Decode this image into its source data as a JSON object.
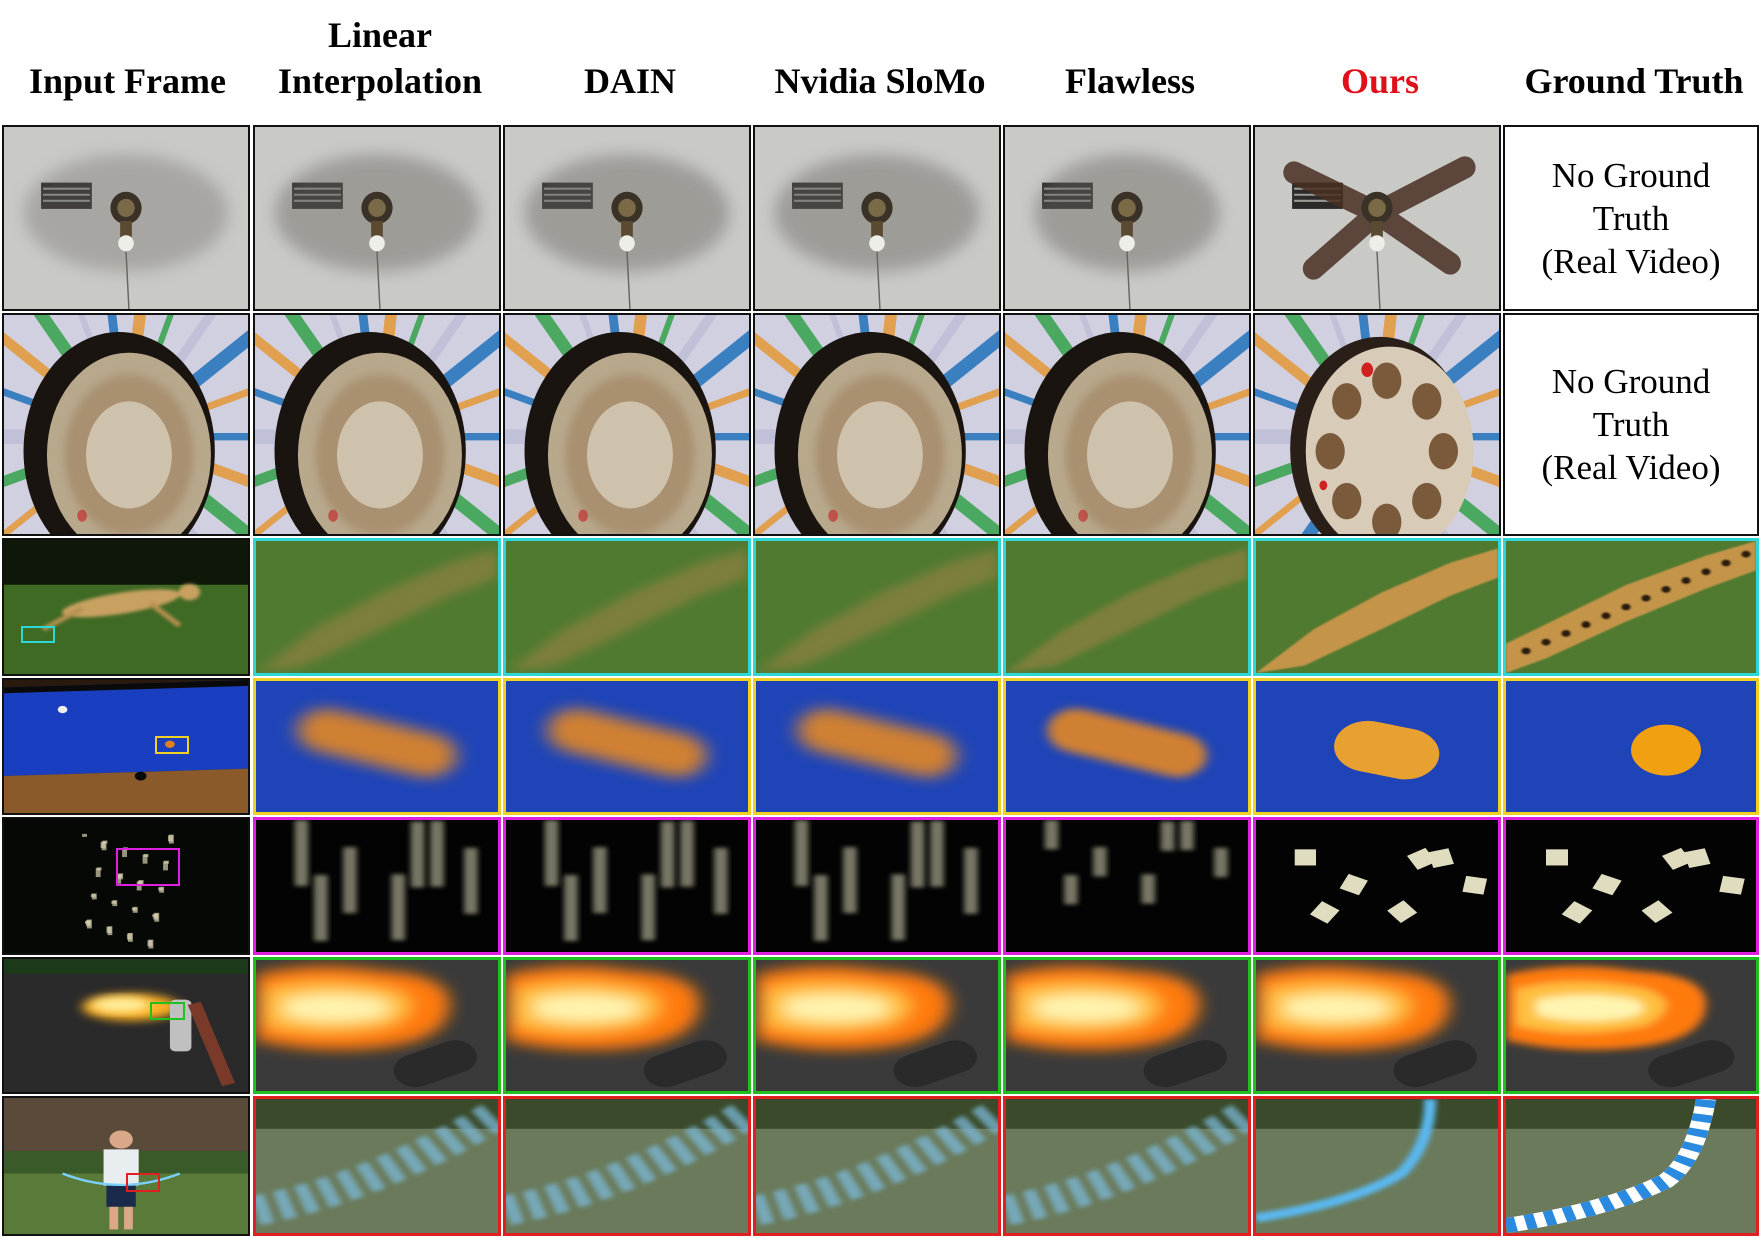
{
  "headers": [
    "Input Frame",
    "Linear\nInterpolation",
    "DAIN",
    "Nvidia SloMo",
    "Flawless",
    "Ours",
    "Ground Truth"
  ],
  "highlight_color": "#e0101a",
  "no_ground_truth_text": "No Ground\nTruth\n(Real Video)",
  "rows": [
    {
      "scene": "ceiling-fan",
      "ground_truth": "none"
    },
    {
      "scene": "spinning-disc",
      "ground_truth": "none"
    },
    {
      "scene": "cheetah",
      "inset_color": "#2fd6d6"
    },
    {
      "scene": "billiard-ball",
      "inset_color": "#f0d020"
    },
    {
      "scene": "falling-dice",
      "inset_color": "#e020e0"
    },
    {
      "scene": "flamethrower",
      "inset_color": "#20c020"
    },
    {
      "scene": "jump-rope",
      "inset_color": "#e02020"
    }
  ]
}
